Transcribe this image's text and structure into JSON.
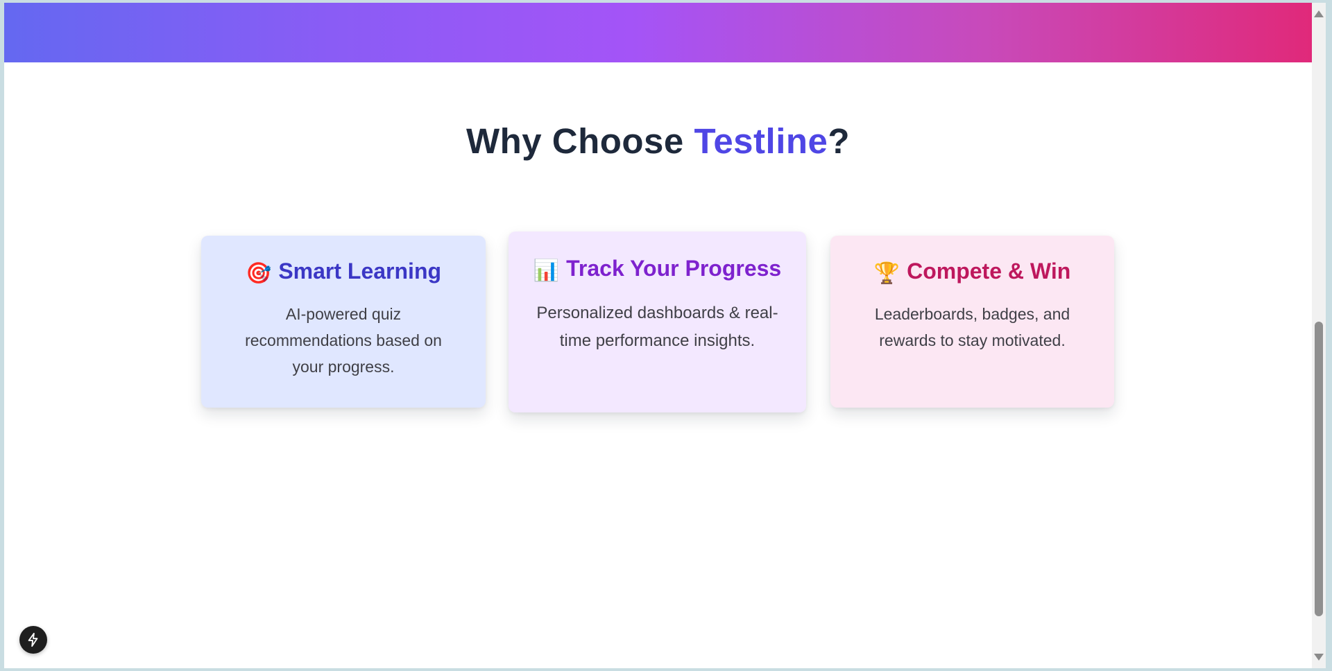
{
  "section": {
    "title_prefix": "Why Choose ",
    "title_brand": "Testline",
    "title_suffix": "?"
  },
  "features": [
    {
      "icon": "🎯",
      "icon_name": "target-icon",
      "title": "Smart Learning",
      "description": "AI-powered quiz recommendations based on your progress."
    },
    {
      "icon": "📊",
      "icon_name": "bar-chart-icon",
      "title": "Track Your Progress",
      "description": "Personalized dashboards & real-time performance insights."
    },
    {
      "icon": "🏆",
      "icon_name": "trophy-icon",
      "title": "Compete & Win",
      "description": "Leaderboards, badges, and rewards to stay motivated."
    }
  ],
  "colors": {
    "brand": "#4f46e5",
    "heading": "#1e293b",
    "card_1_bg": "#e0e7ff",
    "card_2_bg": "#f3e8ff",
    "card_3_bg": "#fce7f3"
  },
  "floating_button": {
    "icon_name": "lightning-bolt-icon"
  }
}
